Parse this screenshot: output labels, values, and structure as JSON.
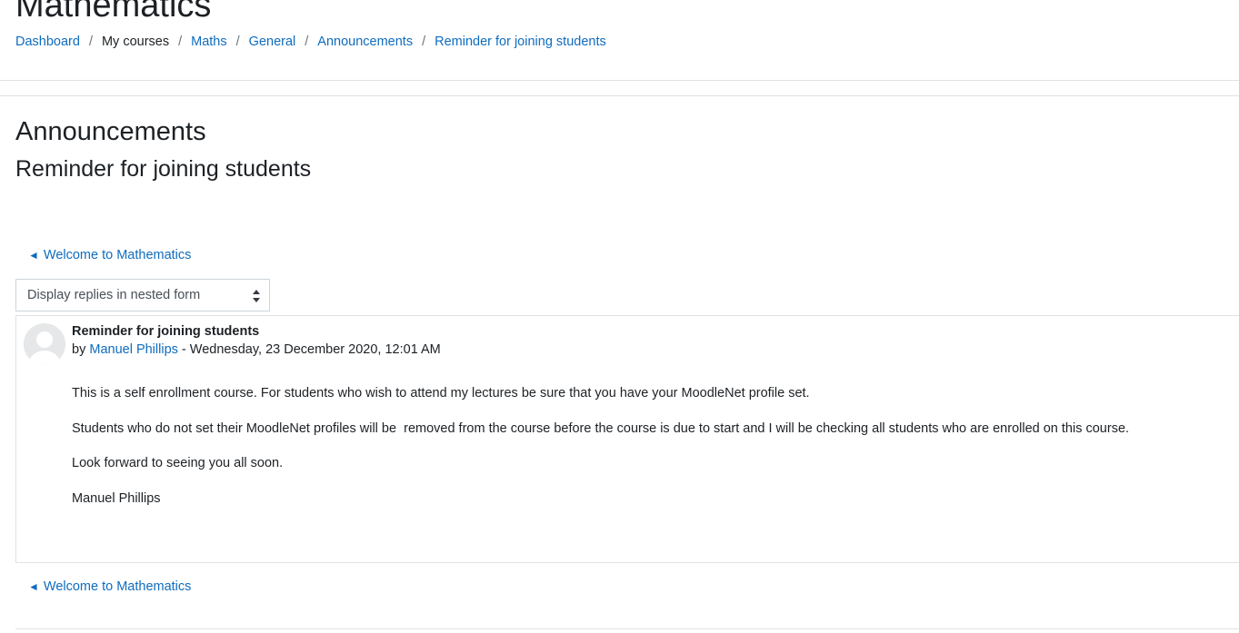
{
  "course": {
    "title": "Mathematics"
  },
  "breadcrumb": {
    "dashboard": "Dashboard",
    "my_courses": "My courses",
    "maths": "Maths",
    "general": "General",
    "announcements": "Announcements",
    "current": "Reminder for joining students",
    "separator": "/"
  },
  "forum": {
    "title": "Announcements",
    "discussion_title": "Reminder for joining students"
  },
  "navigation": {
    "prev_arrow": "◄",
    "prev_label": "Welcome to Mathematics"
  },
  "display_mode": {
    "selected": "Display replies in nested form"
  },
  "post": {
    "subject": "Reminder for joining students",
    "by_prefix": "by",
    "author": "Manuel Phillips",
    "date_separator": "-",
    "date": "Wednesday, 23 December 2020, 12:01 AM",
    "paragraphs": [
      "This is a self enrollment course. For students who wish to attend my lectures be sure that you have your MoodleNet profile set.",
      "Students who do not set their MoodleNet profiles will be  removed from the course before the course is due to start and I will be checking all students who are enrolled on this course.",
      "Look forward to seeing you all soon.",
      "Manuel Phillips"
    ]
  },
  "colors": {
    "link": "#0f6cbf",
    "text": "#1d2125",
    "border": "#dee2e6"
  }
}
